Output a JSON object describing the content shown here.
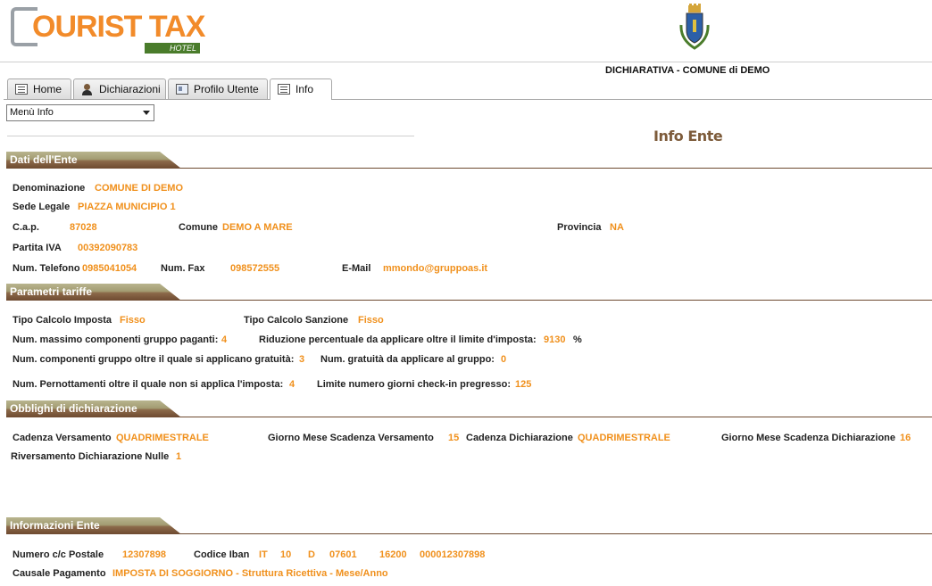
{
  "header": {
    "logo_text": "OURIST TAX",
    "logo_sub": "HOTEL",
    "subtitle": "DICHIARATIVA - COMUNE di DEMO"
  },
  "tabs": [
    {
      "label": "Home",
      "icon": "doc-icon"
    },
    {
      "label": "Dichiarazioni",
      "icon": "user-icon"
    },
    {
      "label": "Profilo Utente",
      "icon": "card-icon"
    },
    {
      "label": "Info",
      "icon": "doc-icon",
      "active": true
    }
  ],
  "menu": {
    "selected": "Menù Info"
  },
  "page_title": "Info Ente",
  "sections": {
    "dati": "Dati dell'Ente",
    "parametri": "Parametri tariffe",
    "obblighi": "Obblighi di dichiarazione",
    "informazioni": "Informazioni Ente"
  },
  "dati": {
    "denominazione_lbl": "Denominazione",
    "denominazione": "COMUNE DI DEMO",
    "sede_lbl": "Sede Legale",
    "sede": "PIAZZA MUNICIPIO 1",
    "cap_lbl": "C.a.p.",
    "cap": "87028",
    "comune_lbl": "Comune",
    "comune": "DEMO A MARE",
    "provincia_lbl": "Provincia",
    "provincia": "NA",
    "piva_lbl": "Partita IVA",
    "piva": "00392090783",
    "tel_lbl": "Num. Telefono",
    "tel": "0985041054",
    "fax_lbl": "Num. Fax",
    "fax": "098572555",
    "email_lbl": "E-Mail",
    "email": "mmondo@gruppoas.it"
  },
  "parametri": {
    "tipo_imposta_lbl": "Tipo Calcolo Imposta",
    "tipo_imposta": "Fisso",
    "tipo_sanzione_lbl": "Tipo Calcolo Sanzione",
    "tipo_sanzione": "Fisso",
    "max_comp_lbl": "Num. massimo componenti gruppo paganti:",
    "max_comp": "4",
    "riduzione_lbl": "Riduzione percentuale da applicare oltre il limite d'imposta:",
    "riduzione": "9130",
    "riduzione_unit": "%",
    "comp_gratuita_lbl": "Num. componenti gruppo oltre il quale si applicano gratuità:",
    "comp_gratuita": "3",
    "num_gratuita_lbl": "Num. gratuità da applicare al gruppo:",
    "num_gratuita": "0",
    "pernott_lbl": "Num. Pernottamenti oltre il quale non si applica l'imposta:",
    "pernott": "4",
    "limite_lbl": "Limite numero giorni check-in pregresso:",
    "limite": "125"
  },
  "obblighi": {
    "cad_vers_lbl": "Cadenza Versamento",
    "cad_vers": "QUADRIMESTRALE",
    "gg_vers_lbl": "Giorno Mese Scadenza Versamento",
    "gg_vers": "15",
    "cad_dich_lbl": "Cadenza Dichiarazione",
    "cad_dich": "QUADRIMESTRALE",
    "gg_dich_lbl": "Giorno Mese Scadenza Dichiarazione",
    "gg_dich": "16",
    "riv_lbl": "Riversamento Dichiarazione Nulle",
    "riv": "1"
  },
  "informazioni": {
    "ccp_lbl": "Numero c/c Postale",
    "ccp": "12307898",
    "iban_lbl": "Codice Iban",
    "iban_1": "IT",
    "iban_2": "10",
    "iban_3": "D",
    "iban_4": "07601",
    "iban_5": "16200",
    "iban_6": "000012307898",
    "causale_lbl": "Causale Pagamento",
    "causale": "IMPOSTA DI SOGGIORNO - Struttura Ricettiva - Mese/Anno"
  },
  "colors": {
    "value": "#f0901c",
    "section_dark": "#6e4a30",
    "title": "#7d5b3a"
  }
}
